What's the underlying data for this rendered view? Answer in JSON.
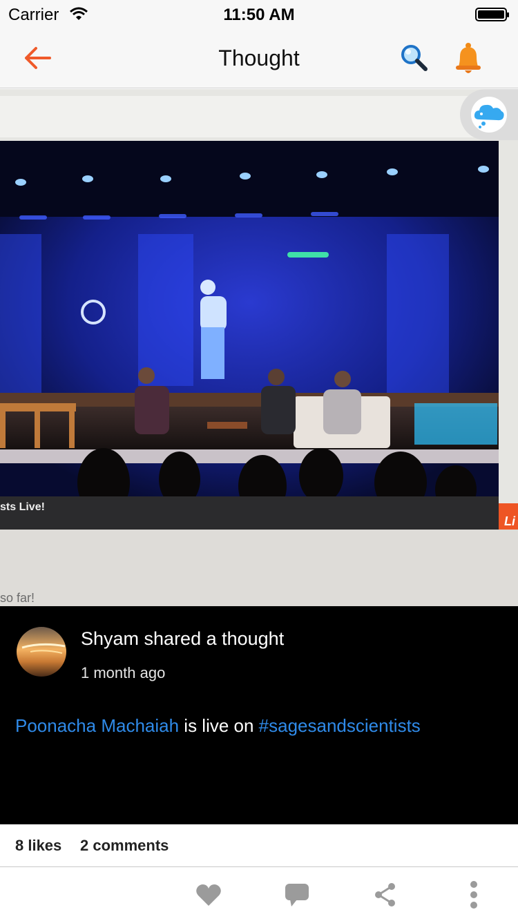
{
  "status_bar": {
    "carrier": "Carrier",
    "time": "11:50 AM"
  },
  "nav": {
    "title": "Thought",
    "back_icon": "back-arrow-icon",
    "search_icon": "search-icon",
    "notifications_icon": "bell-icon",
    "accent_color": "#ef5a2a"
  },
  "photo": {
    "overlay_badge_icon": "thought-cloud-icon",
    "visible_caption_left": "sts Live!",
    "visible_caption_bottom": "so far!",
    "visible_corner_letter": "Li"
  },
  "post": {
    "header": "Shyam shared a thought",
    "time_ago": "1 month ago",
    "author_link": "Poonacha Machaiah",
    "middle_text": " is live on ",
    "hashtag": "#sagesandscientists",
    "link_color": "#2f8ae8"
  },
  "stats": {
    "likes": "8 likes",
    "comments": "2 comments"
  },
  "actions": {
    "like_icon": "heart-icon",
    "comment_icon": "comment-bubble-icon",
    "share_icon": "share-icon",
    "more_icon": "more-vertical-icon"
  }
}
